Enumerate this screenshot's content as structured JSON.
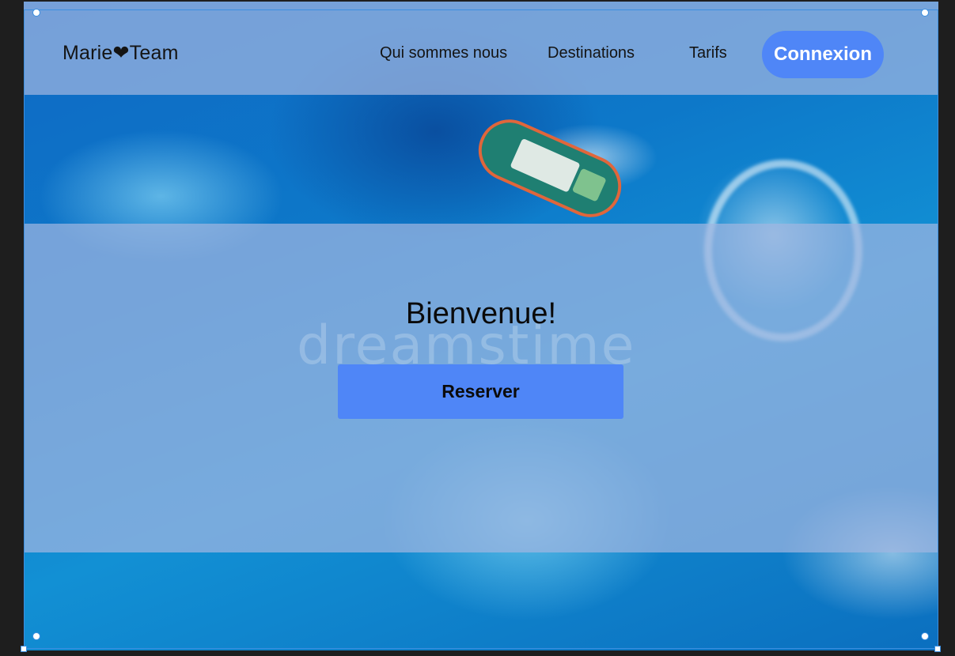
{
  "header": {
    "logo_text": "Marie❤Team",
    "nav": {
      "about": "Qui sommes nous",
      "destinations": "Destinations",
      "tarifs": "Tarifs"
    },
    "login_label": "Connexion"
  },
  "hero": {
    "title": "Bienvenue!",
    "cta_label": "Reserver",
    "watermark": "dreamstime"
  },
  "colors": {
    "accent": "#4f86f7",
    "overlay": "#a0b6e1",
    "ocean": "#0d78c9"
  }
}
